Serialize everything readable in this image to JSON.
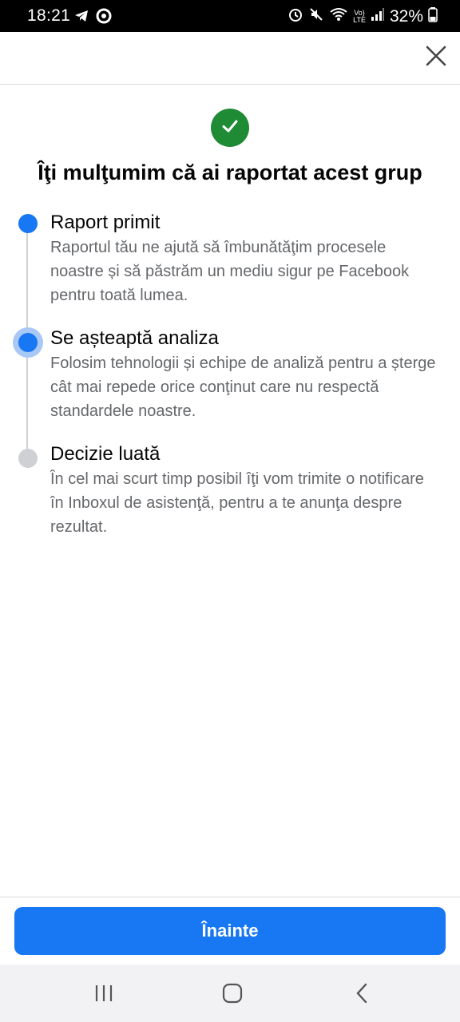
{
  "status_bar": {
    "time": "18:21",
    "battery_percent": "32%",
    "network_label_top": "Vo)",
    "network_label_bottom": "LTE",
    "icons": [
      "telegram-icon",
      "chrome-icon",
      "alarm-icon",
      "mute-icon",
      "wifi-icon",
      "signal-icon",
      "battery-icon"
    ]
  },
  "header": {
    "close_icon": "close-icon"
  },
  "title": "Îţi mulţumim că ai raportat acest grup",
  "steps": [
    {
      "title": "Raport primit",
      "body": "Raportul tău ne ajută să îmbunătăţim procesele noastre și să păstrăm un mediu sigur pe Facebook pentru toată lumea.",
      "state": "done"
    },
    {
      "title": "Se așteaptă analiza",
      "body": "Folosim tehnologii și echipe de analiză pentru a șterge cât mai repede orice conţinut care nu respectă standardele noastre.",
      "state": "current"
    },
    {
      "title": "Decizie luată",
      "body": "În cel mai scurt timp posibil îţi vom trimite o notificare în Inboxul de asistenţă, pentru a te anunţa despre rezultat.",
      "state": "pending"
    }
  ],
  "next_button_label": "Înainte",
  "colors": {
    "accent": "#1877f2",
    "success": "#1f8b34",
    "pending": "#ced0d4",
    "secondary_text": "#65676b"
  }
}
